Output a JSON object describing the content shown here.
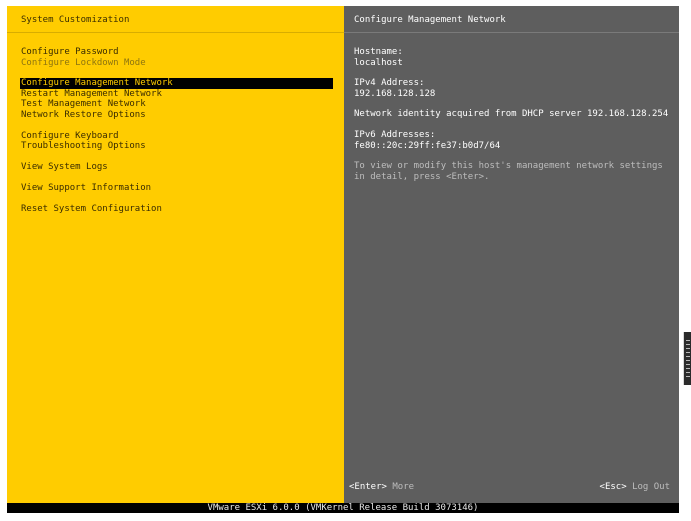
{
  "left_panel": {
    "title": "System Customization",
    "menu": [
      {
        "label": "Configure Password"
      },
      {
        "label": "Configure Lockdown Mode"
      },
      {
        "label": "Configure Management Network"
      },
      {
        "label": "Restart Management Network"
      },
      {
        "label": "Test Management Network"
      },
      {
        "label": "Network Restore Options"
      },
      {
        "label": "Configure Keyboard"
      },
      {
        "label": "Troubleshooting Options"
      },
      {
        "label": "View System Logs"
      },
      {
        "label": "View Support Information"
      },
      {
        "label": "Reset System Configuration"
      }
    ],
    "selected_item": "Configure Management Network"
  },
  "right_panel": {
    "title": "Configure Management Network",
    "hostname_label": "Hostname:",
    "hostname_value": "localhost",
    "ipv4_label": "IPv4 Address:",
    "ipv4_value": "192.168.128.128",
    "dhcp_note": "Network identity acquired from DHCP server 192.168.128.254",
    "ipv6_label": "IPv6 Addresses:",
    "ipv6_value": "fe80::20c:29ff:fe37:b0d7/64",
    "hint": "To view or modify this host's management network settings in detail, press <Enter>.",
    "footer_left_key": "<Enter>",
    "footer_left_desc": "More",
    "footer_right_key": "<Esc>",
    "footer_right_desc": "Log Out"
  },
  "status_bar": {
    "text": "VMware ESXi 6.0.0 (VMKernel Release Build 3073146)"
  },
  "colors": {
    "left_background": "#ffcc00",
    "right_background": "#5e5e5e",
    "selection_background": "#000000",
    "selection_text": "#ffcc00"
  }
}
